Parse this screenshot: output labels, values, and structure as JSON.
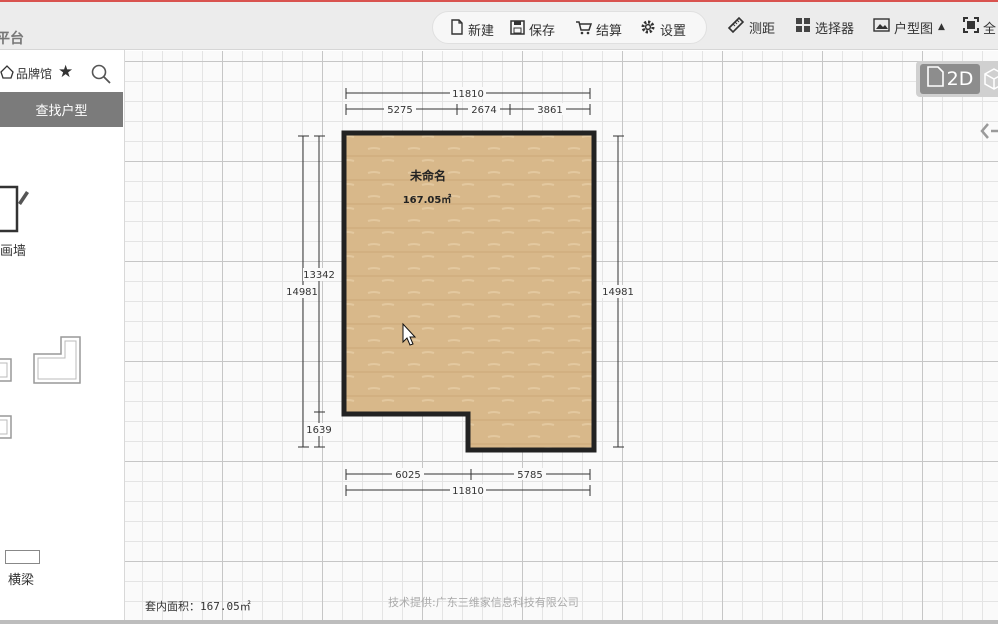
{
  "app": {
    "brand": "平台"
  },
  "toolbar": {
    "new": "新建",
    "save": "保存",
    "settle": "结算",
    "settings": "设置",
    "measure": "测距",
    "selector": "选择器",
    "floorplan": "户型图",
    "fullscreen": "全"
  },
  "sidebar": {
    "brand_hall": "品牌馆",
    "find_floorplan": "查找户型",
    "draw_wall": "画墙",
    "beam": "横梁"
  },
  "view": {
    "mode_2d": "2D"
  },
  "room": {
    "name": "未命名",
    "area": "167.05㎡"
  },
  "dimensions": {
    "top_total": "11810",
    "top_a": "5275",
    "top_b": "2674",
    "top_c": "3861",
    "bottom_a": "6025",
    "bottom_b": "5785",
    "bottom_total": "11810",
    "left_outer": "14981",
    "left_upper": "13342",
    "left_lower": "1639",
    "right": "14981"
  },
  "status": {
    "inner_area": "套内面积：167.05㎡"
  },
  "footer": {
    "credit": "技术提供:广东三维家信息科技有限公司"
  },
  "colors": {
    "accent_line": "#d9534f",
    "floor": "#d8b88a",
    "wall": "#222222",
    "find_bar": "#7b7b7b"
  }
}
